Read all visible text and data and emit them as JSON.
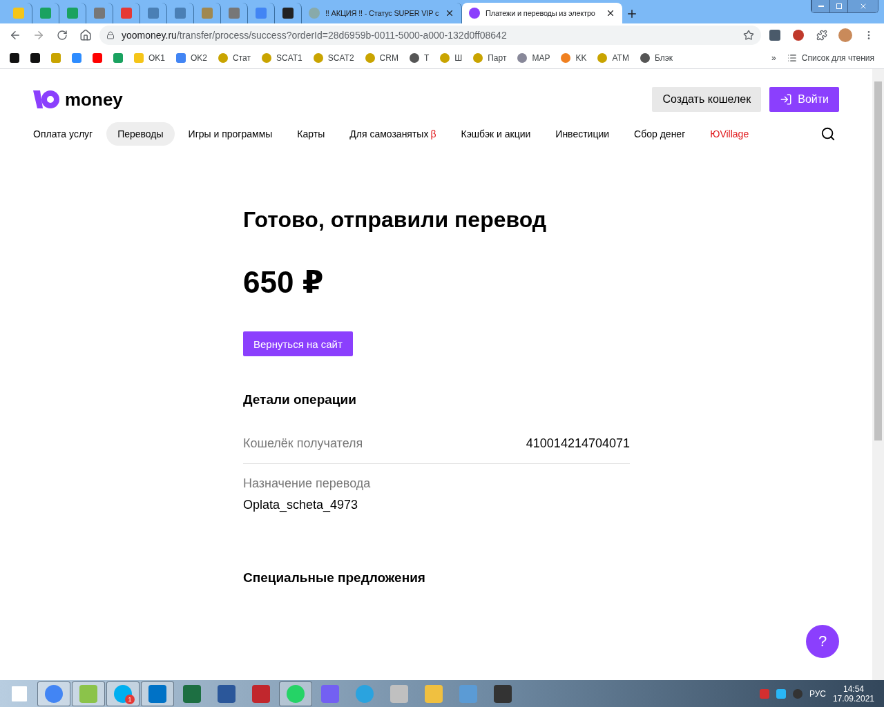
{
  "browser": {
    "tabs": [
      {
        "kind": "pinned",
        "selected": false
      },
      {
        "kind": "pinned",
        "selected": false
      },
      {
        "kind": "pinned",
        "selected": false
      },
      {
        "kind": "pinned",
        "selected": false
      },
      {
        "kind": "pinned",
        "selected": false
      },
      {
        "kind": "pinned",
        "selected": false
      },
      {
        "kind": "pinned",
        "selected": false
      },
      {
        "kind": "pinned",
        "selected": false
      },
      {
        "kind": "pinned",
        "selected": false
      },
      {
        "kind": "pinned",
        "selected": false
      },
      {
        "kind": "pinned",
        "selected": false
      },
      {
        "kind": "full",
        "title": "!! АКЦИЯ !! - Статус SUPER VIP c",
        "selected": false
      },
      {
        "kind": "full",
        "title": "Платежи и переводы из электро",
        "selected": true
      }
    ],
    "address": {
      "host": "yoomoney.ru",
      "path": "/transfer/process/success?orderId=28d6959b-0011-5000-a000-132d0ff08642"
    },
    "bookmarks": [
      {
        "kind": "icon"
      },
      {
        "kind": "icon"
      },
      {
        "kind": "icon"
      },
      {
        "kind": "icon"
      },
      {
        "kind": "icon"
      },
      {
        "kind": "icon"
      },
      {
        "kind": "labeled",
        "label": "OK1"
      },
      {
        "kind": "labeled",
        "label": "OK2"
      },
      {
        "kind": "labeled",
        "label": "Стат"
      },
      {
        "kind": "labeled",
        "label": "SCAT1"
      },
      {
        "kind": "labeled",
        "label": "SCAT2"
      },
      {
        "kind": "labeled",
        "label": "CRM"
      },
      {
        "kind": "labeled",
        "label": "Т"
      },
      {
        "kind": "labeled",
        "label": "Ш"
      },
      {
        "kind": "labeled",
        "label": "Парт"
      },
      {
        "kind": "labeled",
        "label": "MAP"
      },
      {
        "kind": "labeled",
        "label": "KK"
      },
      {
        "kind": "labeled",
        "label": "ATM"
      },
      {
        "kind": "labeled",
        "label": "Блэк"
      }
    ],
    "more": "»",
    "reading_list": "Список для чтения"
  },
  "page": {
    "logo": "money",
    "header_buttons": [
      {
        "kind": "secondary",
        "label": "Создать кошелек"
      },
      {
        "kind": "primary",
        "label": "Войти"
      }
    ],
    "nav": [
      {
        "label": "Оплата услуг",
        "selected": false
      },
      {
        "label": "Переводы",
        "selected": true
      },
      {
        "label": "Игры и программы",
        "selected": false
      },
      {
        "label": "Карты",
        "selected": false
      },
      {
        "label": "Для самозанятых",
        "badge": "β",
        "selected": false
      },
      {
        "label": "Кэшбэк и акции",
        "selected": false
      },
      {
        "label": "Инвестиции",
        "selected": false
      },
      {
        "label": "Сбор денег",
        "selected": false
      },
      {
        "label": "ЮVillage",
        "kind": "promo",
        "selected": false
      }
    ],
    "title": "Готово, отправили перевод",
    "amount": "650 ₽",
    "back_button": "Вернуться на сайт",
    "details_heading": "Детали операции",
    "details": [
      {
        "kind": "inline",
        "label": "Кошелёк получателя",
        "value": "410014214704071"
      },
      {
        "kind": "stacked",
        "label": "Назначение перевода",
        "value": "Oplata_scheta_4973"
      }
    ],
    "offers_heading": "Специальные предложения",
    "help": "?"
  },
  "taskbar": {
    "apps": [
      {
        "active": true
      },
      {
        "active": true
      },
      {
        "active": true,
        "badge": "1"
      },
      {
        "active": true
      },
      {
        "active": false
      },
      {
        "active": false
      },
      {
        "active": false
      },
      {
        "active": true
      },
      {
        "active": false
      },
      {
        "active": false
      },
      {
        "active": false
      },
      {
        "active": false
      },
      {
        "active": false
      },
      {
        "active": false
      }
    ],
    "language": "РУС",
    "time": "14:54",
    "date": "17.09.2021"
  }
}
